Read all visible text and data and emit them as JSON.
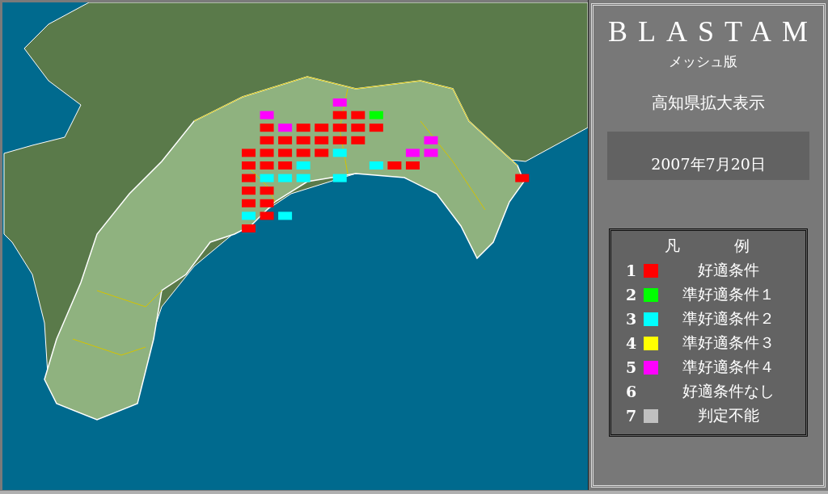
{
  "map": {
    "mesh_cells": [
      {
        "color": "#ff00ff"
      },
      {
        "color": "#ff00ff"
      },
      {
        "color": "#ff0000"
      },
      {
        "color": "#ff0000"
      },
      {
        "color": "#00ff00"
      },
      {
        "color": "#ff0000"
      },
      {
        "color": "#ff00ff"
      },
      {
        "color": "#ff0000"
      },
      {
        "color": "#ff0000"
      },
      {
        "color": "#ff0000"
      },
      {
        "color": "#ff0000"
      },
      {
        "color": "#ff0000"
      },
      {
        "color": "#ff0000"
      },
      {
        "color": "#ff0000"
      },
      {
        "color": "#ff0000"
      },
      {
        "color": "#ff0000"
      },
      {
        "color": "#ff0000"
      },
      {
        "color": "#ff0000"
      },
      {
        "color": "#ff00ff"
      },
      {
        "color": "#ff0000"
      },
      {
        "color": "#ff0000"
      },
      {
        "color": "#ff0000"
      },
      {
        "color": "#ff0000"
      },
      {
        "color": "#ff0000"
      },
      {
        "color": "#00ffff"
      },
      {
        "color": "#ff00ff"
      },
      {
        "color": "#ff00ff"
      },
      {
        "color": "#ff0000"
      },
      {
        "color": "#ff0000"
      },
      {
        "color": "#ff0000"
      },
      {
        "color": "#00ffff"
      },
      {
        "color": "#00ffff"
      },
      {
        "color": "#ff0000"
      },
      {
        "color": "#ff0000"
      },
      {
        "color": "#ff0000"
      },
      {
        "color": "#00ffff"
      },
      {
        "color": "#00ffff"
      },
      {
        "color": "#00ffff"
      },
      {
        "color": "#00ffff"
      },
      {
        "color": "#ff0000"
      },
      {
        "color": "#ff0000"
      },
      {
        "color": "#ff0000"
      },
      {
        "color": "#ff0000"
      },
      {
        "color": "#ff0000"
      },
      {
        "color": "#00ffff"
      },
      {
        "color": "#ff0000"
      },
      {
        "color": "#00ffff"
      },
      {
        "color": "#ff0000"
      }
    ]
  },
  "panel": {
    "title": "BLASTAM",
    "subtitle": "メッシュ版",
    "view": "高知県拡大表示",
    "date": "2007年7月20日",
    "legend": {
      "title": "凡　例",
      "items": [
        {
          "number": "1",
          "label": "好適条件",
          "color": "#ff0000"
        },
        {
          "number": "2",
          "label": "準好適条件１",
          "color": "#00ff00"
        },
        {
          "number": "3",
          "label": "準好適条件２",
          "color": "#00ffff"
        },
        {
          "number": "4",
          "label": "準好適条件３",
          "color": "#ffff00"
        },
        {
          "number": "5",
          "label": "準好適条件４",
          "color": "#ff00ff"
        },
        {
          "number": "6",
          "label": "好適条件なし"
        },
        {
          "number": "7",
          "label": "判定不能",
          "color": "#c0c0c0"
        }
      ]
    }
  }
}
